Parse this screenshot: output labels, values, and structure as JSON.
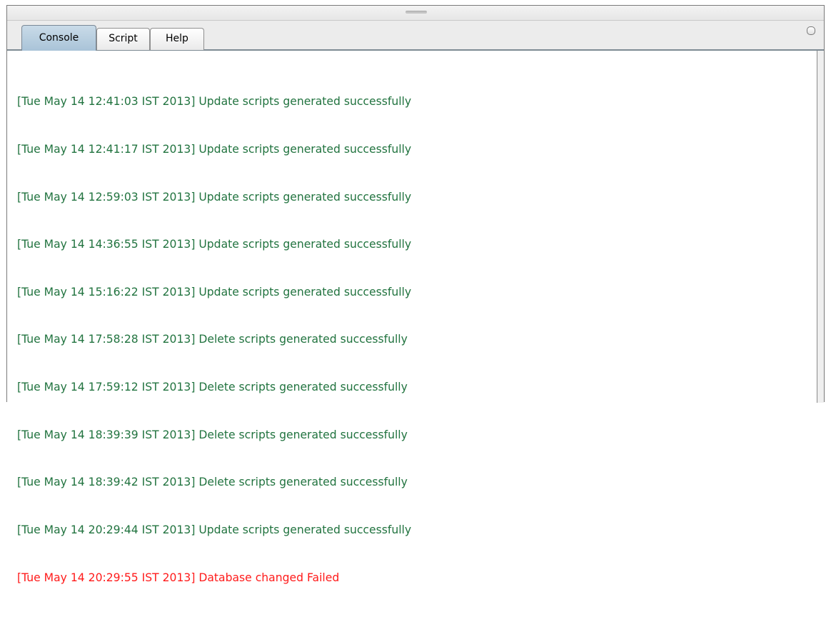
{
  "tabs": [
    {
      "label": "Console",
      "active": true
    },
    {
      "label": "Script",
      "active": false
    },
    {
      "label": "Help",
      "active": false
    }
  ],
  "colors": {
    "success_text": "#21733f",
    "error_text": "#ff1a1a",
    "active_tab": "#b8cfe0"
  },
  "icons": {
    "splitter": "grip-icon",
    "maximize": "maximize-icon"
  },
  "console": {
    "lines": [
      {
        "text": "[Tue May 14 12:41:03 IST 2013] Update scripts generated successfully",
        "status": "success"
      },
      {
        "text": "[Tue May 14 12:41:17 IST 2013] Update scripts generated successfully",
        "status": "success"
      },
      {
        "text": "[Tue May 14 12:59:03 IST 2013] Update scripts generated successfully",
        "status": "success"
      },
      {
        "text": "[Tue May 14 14:36:55 IST 2013] Update scripts generated successfully",
        "status": "success"
      },
      {
        "text": "[Tue May 14 15:16:22 IST 2013] Update scripts generated successfully",
        "status": "success"
      },
      {
        "text": "[Tue May 14 17:58:28 IST 2013] Delete scripts generated successfully",
        "status": "success"
      },
      {
        "text": "[Tue May 14 17:59:12 IST 2013] Delete scripts generated successfully",
        "status": "success"
      },
      {
        "text": "[Tue May 14 18:39:39 IST 2013] Delete scripts generated successfully",
        "status": "success"
      },
      {
        "text": "[Tue May 14 18:39:42 IST 2013] Delete scripts generated successfully",
        "status": "success"
      },
      {
        "text": "[Tue May 14 20:29:44 IST 2013] Update scripts generated successfully",
        "status": "success"
      },
      {
        "text": "[Tue May 14 20:29:55 IST 2013] Database changed Failed",
        "status": "error"
      }
    ]
  }
}
